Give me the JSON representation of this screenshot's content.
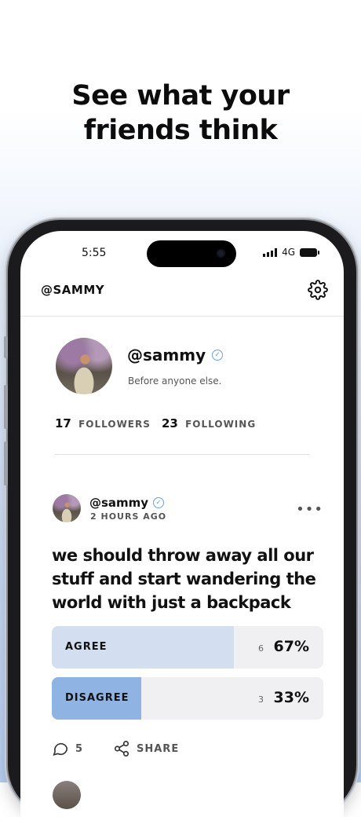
{
  "promo": {
    "headline_line1": "See what your",
    "headline_line2": "friends think"
  },
  "status_bar": {
    "time": "5:55",
    "network": "4G"
  },
  "header": {
    "title": "@SAMMY",
    "settings_icon": "gear-icon"
  },
  "profile": {
    "username": "@sammy",
    "bio": "Before anyone else.",
    "followers_count": "17",
    "followers_label": "FOLLOWERS",
    "following_count": "23",
    "following_label": "FOLLOWING"
  },
  "post": {
    "username": "@sammy",
    "time": "2 HOURS AGO",
    "text": "we should throw away all our stuff and start wandering the world with just a backpack",
    "more_icon": "more-icon",
    "options": [
      {
        "label": "AGREE",
        "count": "6",
        "percent": "67%",
        "fraction": 0.67,
        "color": "#d3dff0"
      },
      {
        "label": "DISAGREE",
        "count": "3",
        "percent": "33%",
        "fraction": 0.33,
        "color": "#8fb3e3"
      }
    ],
    "comments_count": "5",
    "share_label": "SHARE"
  },
  "colors": {
    "verified": "#6b9fe0",
    "agree_fill": "#d3dff0",
    "disagree_fill": "#8fb3e3"
  }
}
